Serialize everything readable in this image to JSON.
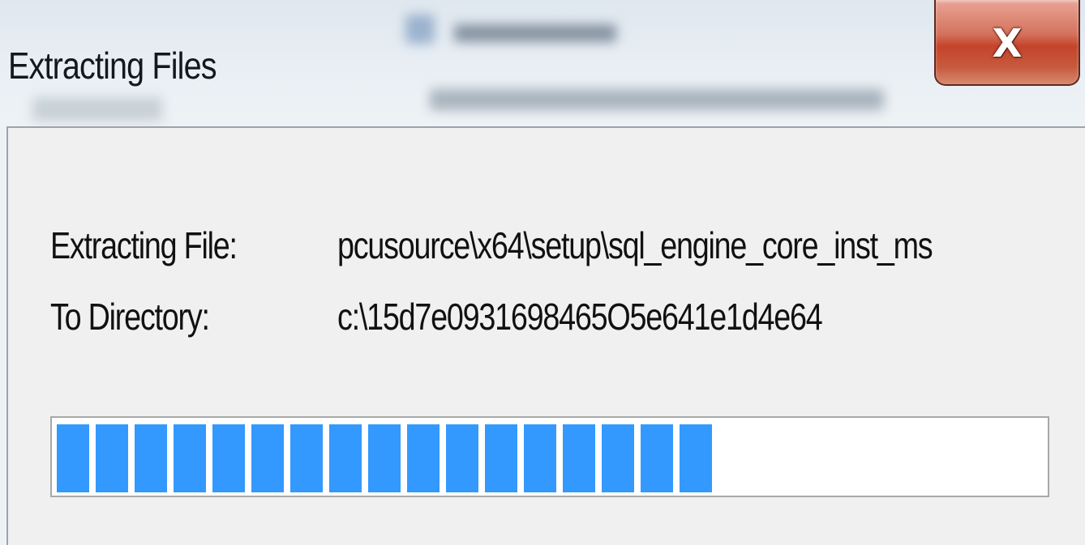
{
  "window": {
    "title": "Extracting Files",
    "close_glyph": "X"
  },
  "labels": {
    "file_label": "Extracting File:",
    "file_value": "pcusource\\x64\\setup\\sql_engine_core_inst_ms",
    "dir_label": "To Directory:",
    "dir_value": "c:\\15d7e0931698465O5e641e1d4e64"
  },
  "progress": {
    "fraction": 0.66
  },
  "colors": {
    "progress_block": "#3399ff",
    "close_button": "#c4442a"
  },
  "icons": {
    "close": "close-icon"
  }
}
